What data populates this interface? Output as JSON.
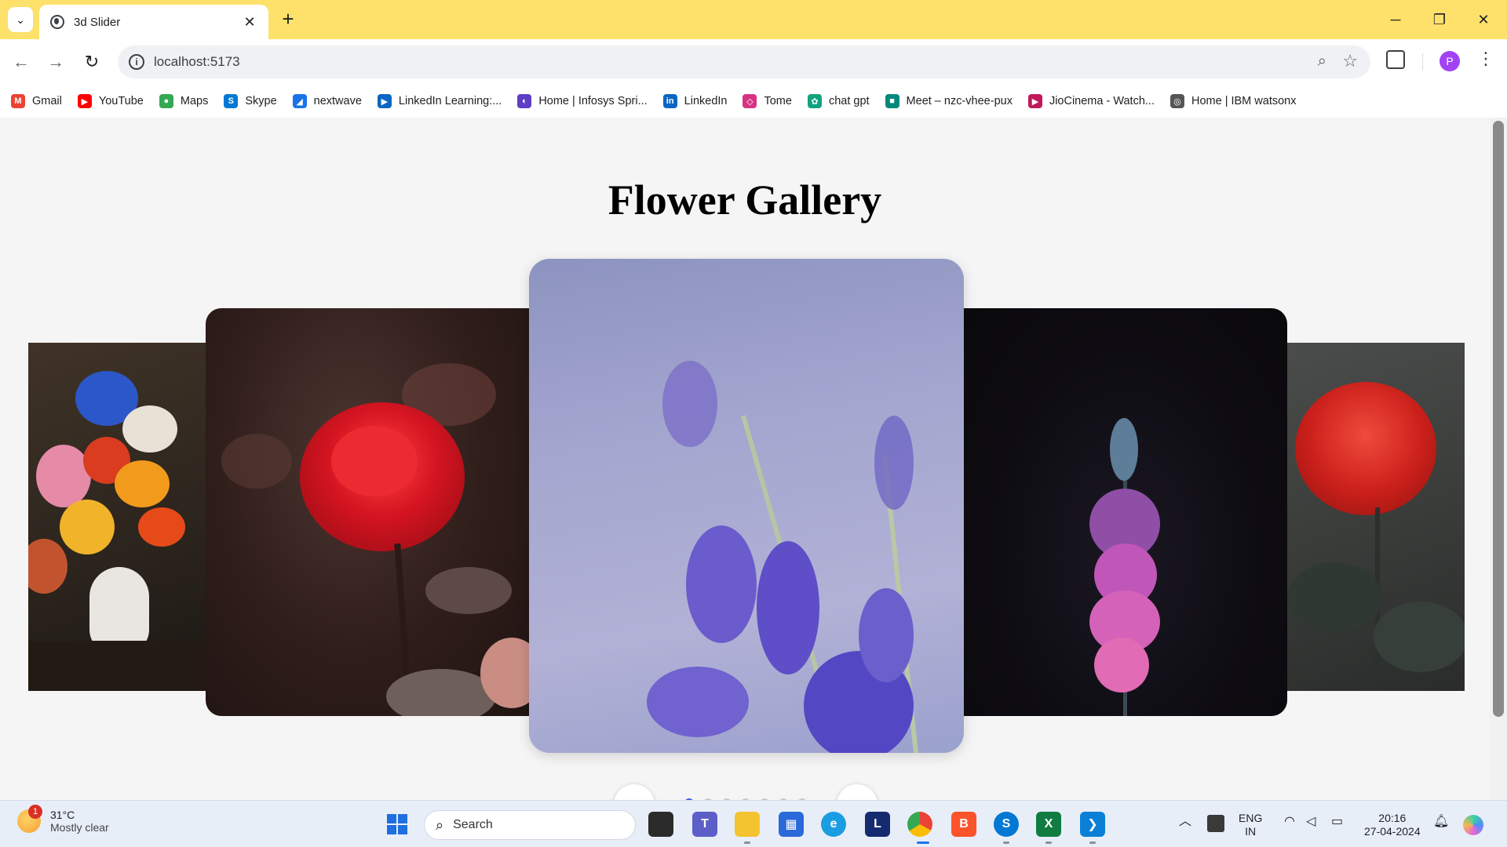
{
  "browser": {
    "tab_title": "3d Slider",
    "tab_close": "✕",
    "new_tab": "+",
    "url": "localhost:5173",
    "profile_initial": "P",
    "window_controls": {
      "minimize": "─",
      "restore": "❐",
      "close": "✕"
    }
  },
  "bookmarks": [
    {
      "label": "Gmail",
      "icon": "gmail-icon",
      "color": "#ea4335",
      "glyph": "M"
    },
    {
      "label": "YouTube",
      "icon": "youtube-icon",
      "color": "#ff0000",
      "glyph": "▶"
    },
    {
      "label": "Maps",
      "icon": "maps-icon",
      "color": "#34a853",
      "glyph": "●"
    },
    {
      "label": "Skype",
      "icon": "skype-icon",
      "color": "#0078d4",
      "glyph": "S"
    },
    {
      "label": "nextwave",
      "icon": "nextwave-icon",
      "color": "#1a73e8",
      "glyph": "◢"
    },
    {
      "label": "LinkedIn Learning:...",
      "icon": "linkedin-learning-icon",
      "color": "#0a66c2",
      "glyph": "▶"
    },
    {
      "label": "Home | Infosys Spri...",
      "icon": "infosys-icon",
      "color": "#5f3dc4",
      "glyph": "◐"
    },
    {
      "label": "LinkedIn",
      "icon": "linkedin-icon",
      "color": "#0a66c2",
      "glyph": "in"
    },
    {
      "label": "Tome",
      "icon": "tome-icon",
      "color": "#d63384",
      "glyph": "◇"
    },
    {
      "label": "chat gpt",
      "icon": "chatgpt-icon",
      "color": "#10a37f",
      "glyph": "✿"
    },
    {
      "label": "Meet – nzc-vhee-pux",
      "icon": "meet-icon",
      "color": "#00897b",
      "glyph": "■"
    },
    {
      "label": "JioCinema - Watch...",
      "icon": "jiocinema-icon",
      "color": "#c2185b",
      "glyph": "▶"
    },
    {
      "label": "Home | IBM watsonx",
      "icon": "watsonx-icon",
      "color": "#555555",
      "glyph": "◎"
    }
  ],
  "page": {
    "title": "Flower Gallery",
    "prev_label": "‹",
    "next_label": "›",
    "slide_count": 7,
    "active_slide": 0
  },
  "taskbar": {
    "weather_temp": "31°C",
    "weather_desc": "Mostly clear",
    "weather_badge": "1",
    "search_label": "Search",
    "lang_top": "ENG",
    "lang_bottom": "IN",
    "time": "20:16",
    "date": "27-04-2024"
  }
}
